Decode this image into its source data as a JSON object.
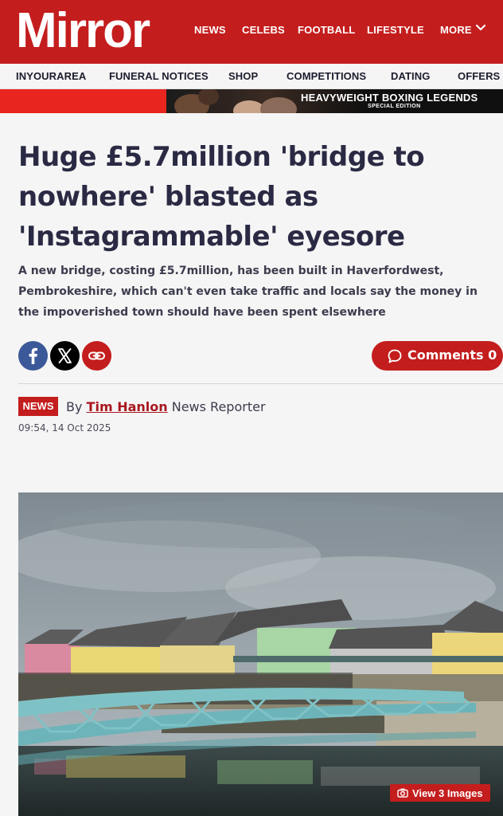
{
  "header": {
    "logo": "Mirror",
    "nav": [
      "NEWS",
      "CELEBS",
      "FOOTBALL",
      "LIFESTYLE",
      "MORE"
    ],
    "subnav": [
      "INYOURAREA",
      "FUNERAL NOTICES",
      "SHOP",
      "COMPETITIONS",
      "DATING",
      "OFFERS"
    ]
  },
  "promo": {
    "title": "HEAVYWEIGHT BOXING LEGENDS",
    "subtitle": "SPECIAL EDITION"
  },
  "article": {
    "headline": "Huge £5.7million 'bridge to nowhere' blasted as 'Instagrammable' eyesore",
    "standfirst": "A new bridge, costing £5.7million, has been built in Haverfordwest, Pembrokeshire, which can't even take traffic and locals say the money in the impoverished town should have been spent elsewhere",
    "category": "NEWS",
    "by": "By",
    "author": "Tim Hanlon",
    "role": "News Reporter",
    "date": "09:54, 14 Oct 2025",
    "comments": "Comments 0",
    "view_images": "View 3 Images"
  },
  "share": {
    "icons": [
      "facebook-icon",
      "x-icon",
      "link-icon"
    ]
  },
  "colors": {
    "brand_red": "#c41d1d",
    "facebook_blue": "#3b5998",
    "headline": "#2a2a44"
  }
}
